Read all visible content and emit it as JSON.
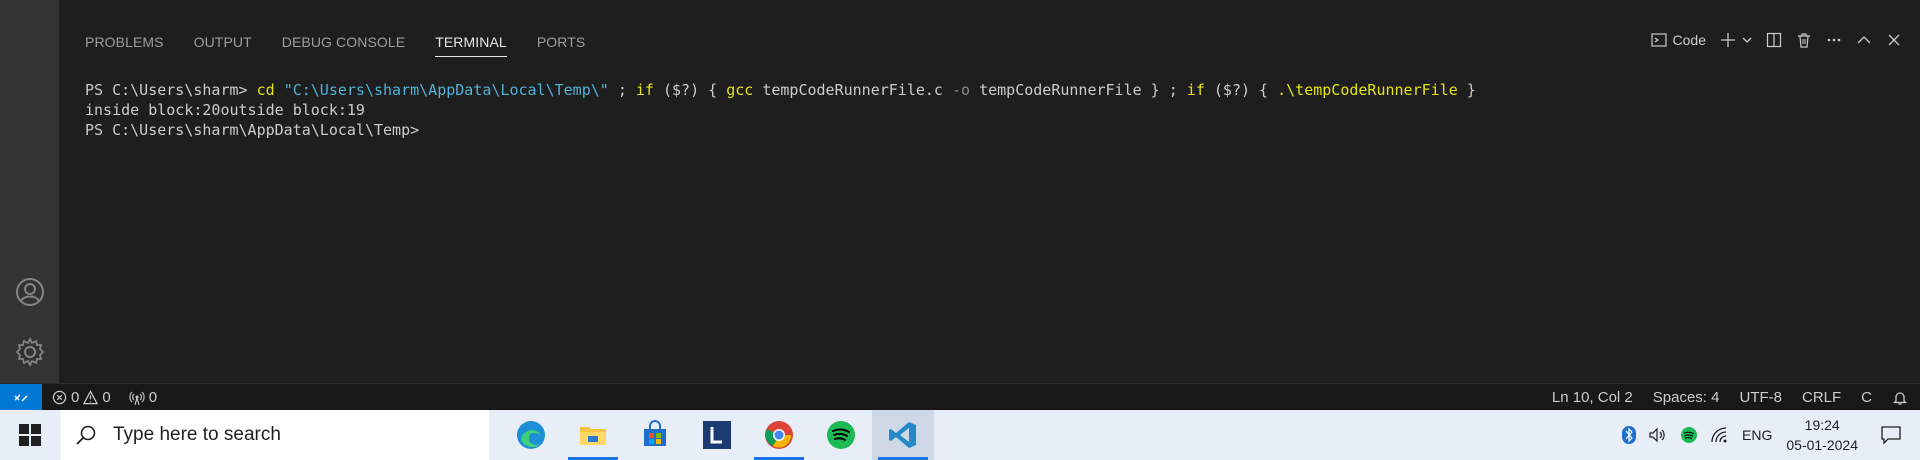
{
  "panel": {
    "tabs": [
      {
        "label": "PROBLEMS"
      },
      {
        "label": "OUTPUT"
      },
      {
        "label": "DEBUG CONSOLE"
      },
      {
        "label": "TERMINAL"
      },
      {
        "label": "PORTS"
      }
    ],
    "active_tab": "TERMINAL",
    "terminal_label": "Code"
  },
  "terminal": {
    "prompt1": "PS C:\\Users\\sharm> ",
    "cmd": "cd",
    "path_str": "\"C:\\Users\\sharm\\AppData\\Local\\Temp\\\"",
    "sep1": " ; ",
    "if1": "if",
    "cond1": " ($?) { ",
    "gcc": "gcc",
    "gcc_args": " tempCodeRunnerFile.c ",
    "flag": "-o",
    "out_file": " tempCodeRunnerFile } ; ",
    "if2": "if",
    "cond2": " ($?) { ",
    "exec": ".\\tempCodeRunnerFile",
    "close": " }",
    "output": "inside block:20outside block:19",
    "prompt2": "PS C:\\Users\\sharm\\AppData\\Local\\Temp>"
  },
  "statusbar": {
    "errors": "0",
    "warnings": "0",
    "ports": "0",
    "position": "Ln 10, Col 2",
    "spaces": "Spaces: 4",
    "encoding": "UTF-8",
    "eol": "CRLF",
    "language": "C"
  },
  "taskbar": {
    "search_placeholder": "Type here to search",
    "lang": "ENG",
    "time": "19:24",
    "date": "05-01-2024"
  },
  "colors": {
    "accent": "#0078d4",
    "terminal_keyword": "#e5e510",
    "terminal_string": "#4fb1d6"
  }
}
